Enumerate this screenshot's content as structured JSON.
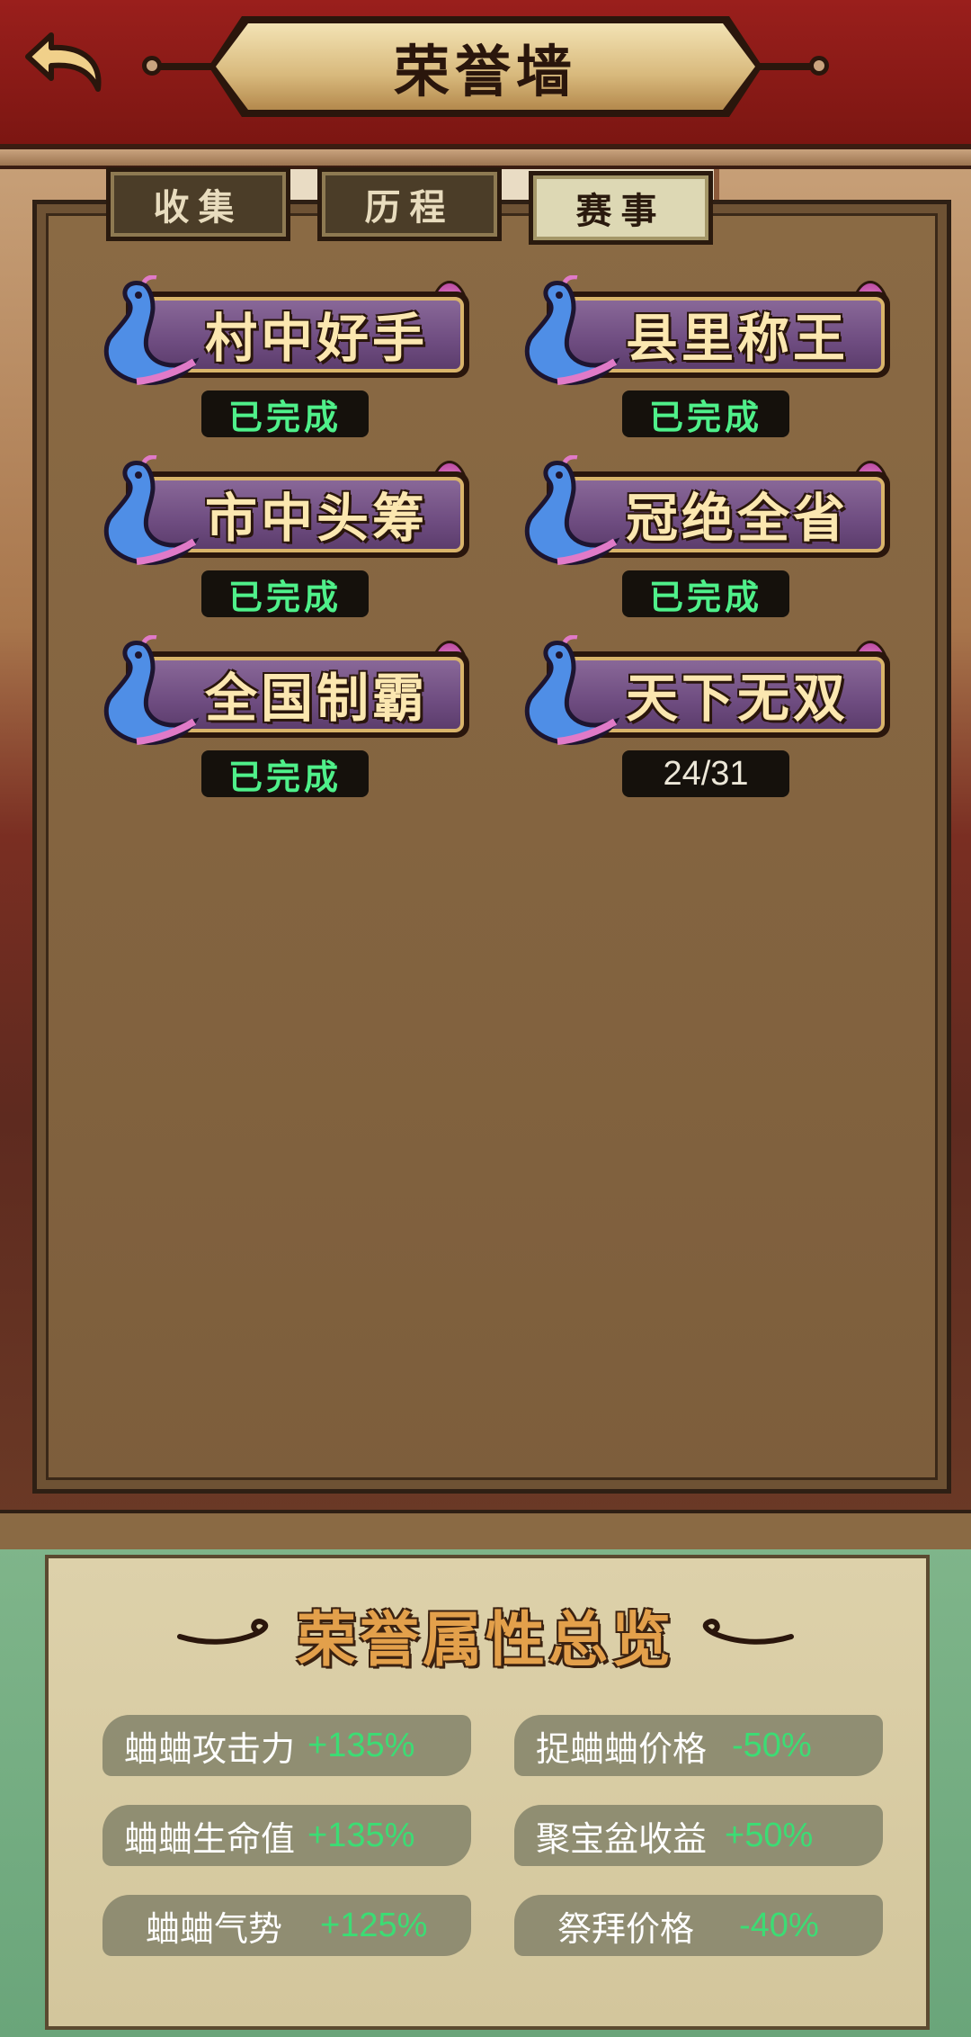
{
  "header": {
    "title": "荣誉墙",
    "back_icon": "back-arrow-icon"
  },
  "tabs": [
    {
      "label": "收集",
      "active": false
    },
    {
      "label": "历程",
      "active": false
    },
    {
      "label": "赛事",
      "active": true
    }
  ],
  "achievements": [
    {
      "name": "村中好手",
      "status": "已完成",
      "completed": true
    },
    {
      "name": "县里称王",
      "status": "已完成",
      "completed": true
    },
    {
      "name": "市中头筹",
      "status": "已完成",
      "completed": true
    },
    {
      "name": "冠绝全省",
      "status": "已完成",
      "completed": true
    },
    {
      "name": "全国制霸",
      "status": "已完成",
      "completed": true
    },
    {
      "name": "天下无双",
      "status": "24/31",
      "completed": false
    }
  ],
  "summary": {
    "title": "荣誉属性总览",
    "stats": [
      {
        "label": "蛐蛐攻击力",
        "value": "+135%"
      },
      {
        "label": "捉蛐蛐价格",
        "value": "-50%"
      },
      {
        "label": "蛐蛐生命值",
        "value": "+135%"
      },
      {
        "label": "聚宝盆收益",
        "value": "+50%"
      },
      {
        "label": "蛐蛐气势",
        "value": "+125%"
      },
      {
        "label": "祭拜价格",
        "value": "-40%"
      }
    ]
  },
  "colors": {
    "header_red": "#9a1f1c",
    "complete_green": "#4ff08a",
    "stat_green": "#3cdc74",
    "plaque_purple": "#6e4c80"
  }
}
